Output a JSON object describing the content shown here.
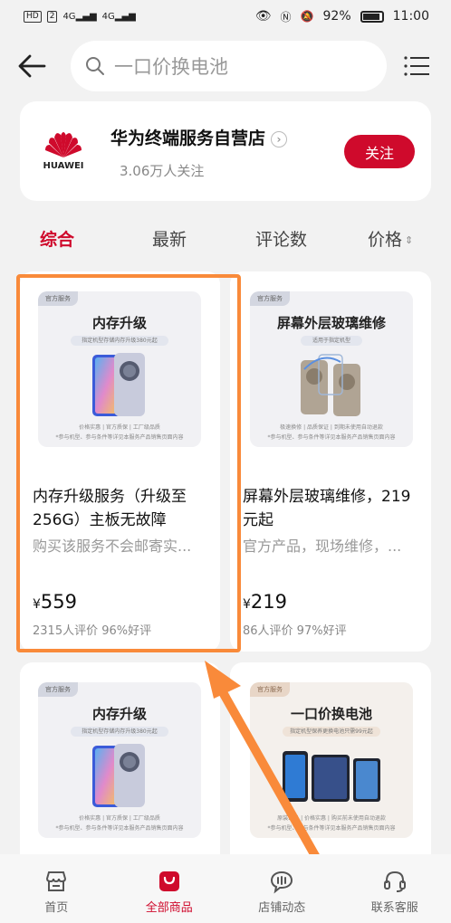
{
  "status": {
    "left_badge": "HD",
    "left_badge2": "2",
    "net1": "4G",
    "net2": "4G",
    "battery": "92%",
    "time": "11:00"
  },
  "search": {
    "placeholder": "一口价换电池"
  },
  "store": {
    "logo_text": "HUAWEI",
    "name": "华为终端服务自营店",
    "fans": "3.06万人关注",
    "follow": "关注"
  },
  "sort": {
    "tabs": [
      "综合",
      "最新",
      "评论数",
      "价格"
    ],
    "active": "综合"
  },
  "products": [
    {
      "thumb_tag": "官方服务",
      "thumb_title": "内存升级",
      "thumb_sub": "指定机型存储内存升级380元起",
      "thumb_foot": "价格实惠 | 官方质保 | 工厂级品质",
      "thumb_foot2": "*参与机型、参与条件等详见本服务产品销售页面内容",
      "title": "内存升级服务（升级至256G）主板无故障",
      "desc": "购买该服务不会邮寄实...",
      "price_symbol": "¥",
      "price": "559",
      "reviews": "2315人评价 96%好评"
    },
    {
      "thumb_tag": "官方服务",
      "thumb_title": "屏幕外层玻璃维修",
      "thumb_sub": "适用于指定机型",
      "thumb_foot": "极速换修 | 品质保证 | 到期未使用自动退款",
      "thumb_foot2": "*参与机型、参与条件等详见本服务产品销售页面内容",
      "title": "屏幕外层玻璃维修，219元起",
      "desc": "官方产品，现场维修，...",
      "price_symbol": "¥",
      "price": "219",
      "reviews": "86人评价 97%好评"
    },
    {
      "thumb_tag": "官方服务",
      "thumb_title": "内存升级",
      "thumb_sub": "指定机型存储内存升级380元起",
      "thumb_foot": "价格实惠 | 官方质保 | 工厂级品质",
      "thumb_foot2": "*参与机型、参与条件等详见本服务产品销售页面内容"
    },
    {
      "thumb_tag": "官方服务",
      "thumb_title": "一口价换电池",
      "thumb_sub": "指定机型保养更换电池只需99元起",
      "thumb_foot": "原装正品 | 价格实惠 | 购买前未使用自动退款",
      "thumb_foot2": "*参与机型、参与条件等详见本服务产品销售页面内容"
    }
  ],
  "tabbar": {
    "items": [
      "首页",
      "全部商品",
      "店铺动态",
      "联系客服"
    ],
    "active": "全部商品"
  },
  "colors": {
    "accent": "#cf0a2c",
    "highlight": "#f98a3a"
  }
}
